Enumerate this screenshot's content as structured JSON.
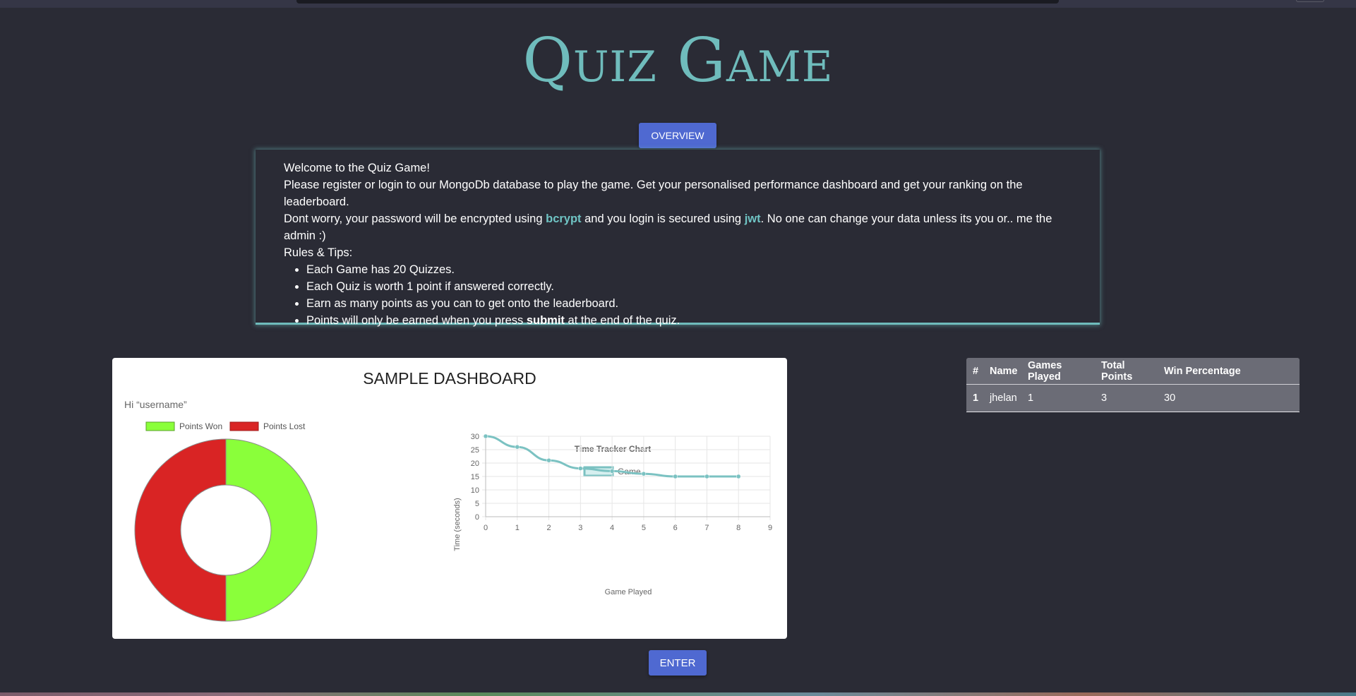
{
  "app": {
    "title": "Quiz Game",
    "overview_label": "OVERVIEW",
    "enter_label": "ENTER"
  },
  "overview": {
    "welcome": "Welcome to the Quiz Game!",
    "intro": "Please register or login to our MongoDb database to play the game. Get your personalised performance dashboard and get your ranking on the leaderboard.",
    "security_1": "Dont worry, your password will be encrypted using ",
    "bcrypt": "bcrypt",
    "security_2": " and you login is secured using ",
    "jwt": "jwt",
    "security_3": ". No one can change your data unless its you or.. me the admin :)",
    "rules_heading": "Rules & Tips:",
    "rules": [
      "Each Game has 20 Quizzes.",
      "Each Quiz is worth 1 point if answered correctly.",
      "Earn as many points as you can to get onto the leaderboard."
    ],
    "rule4_pre": "Points will only be earned when you press ",
    "rule4_bold": "submit",
    "rule4_post": " at the end of the quiz."
  },
  "dashboard": {
    "title": "SAMPLE DASHBOARD",
    "greeting": "Hi “username”"
  },
  "chart_data": [
    {
      "type": "pie",
      "variant": "doughnut",
      "labels": [
        "Points Won",
        "Points Lost"
      ],
      "values": [
        50,
        50
      ],
      "colors": [
        "#8aff3a",
        "#d92424"
      ],
      "legend": "top"
    },
    {
      "type": "line",
      "title": "Time Tracker Chart",
      "xlabel": "Game Played",
      "ylabel": "Time (seconds)",
      "series": [
        {
          "name": "Game",
          "x": [
            0,
            1,
            2,
            3,
            4,
            5,
            6,
            7,
            8
          ],
          "y": [
            30,
            26,
            21,
            18,
            17,
            16,
            15,
            15,
            15
          ]
        }
      ],
      "xlim": [
        0,
        9
      ],
      "ylim": [
        0,
        30
      ],
      "xticks": [
        0,
        1,
        2,
        3,
        4,
        5,
        6,
        7,
        8,
        9
      ],
      "yticks": [
        0,
        5,
        10,
        15,
        20,
        25,
        30
      ],
      "grid": true,
      "legend": "top",
      "color": "#7bc2c2"
    }
  ],
  "leaderboard": {
    "headers": [
      "#",
      "Name",
      "Games Played",
      "Total Points",
      "Win Percentage"
    ],
    "rows": [
      [
        "1",
        "jhelan",
        "1",
        "3",
        "30"
      ]
    ]
  },
  "colors": {
    "background": "#2a2b35",
    "accent": "#6fbcbc",
    "button": "#4f69d1"
  }
}
